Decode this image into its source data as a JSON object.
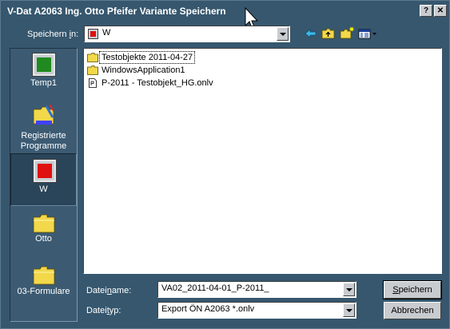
{
  "window": {
    "title": "V-Dat A2063 Ing. Otto Pfeifer Variante Speichern",
    "help_label": "?",
    "close_label": "✕"
  },
  "save_in": {
    "label_pre": "Speichern ",
    "label_ul": "i",
    "label_post": "n:",
    "value": "W"
  },
  "places": [
    {
      "label": "Temp1",
      "icon": "green-square-icon"
    },
    {
      "label": "Registrierte Programme",
      "icon": "registered-programs-icon"
    },
    {
      "label": "W",
      "icon": "red-square-icon",
      "selected": true
    },
    {
      "label": "Otto",
      "icon": "folder-icon"
    },
    {
      "label": "03-Formulare",
      "icon": "folder-icon"
    }
  ],
  "files": [
    {
      "name": "Testobjekte 2011-04-27",
      "icon": "folder-icon"
    },
    {
      "name": "WindowsApplication1",
      "icon": "folder-icon"
    },
    {
      "name": "P-2011 - Testobjekt_HG.onlv",
      "icon": "document-icon"
    }
  ],
  "filename": {
    "label_pre": "Datei",
    "label_ul": "n",
    "label_post": "ame:",
    "value": "VA02_2011-04-01_P-2011_"
  },
  "filetype": {
    "label_pre": "Datei",
    "label_ul": "t",
    "label_post": "yp:",
    "value": "Export ÖN A2063 *.onlv"
  },
  "buttons": {
    "save_ul": "S",
    "save_rest": "peichern",
    "cancel": "Abbrechen"
  },
  "colors": {
    "background": "#36576e",
    "accent_green": "#1f8a1f",
    "accent_red": "#e01010",
    "folder_yellow": "#f2d84a"
  }
}
